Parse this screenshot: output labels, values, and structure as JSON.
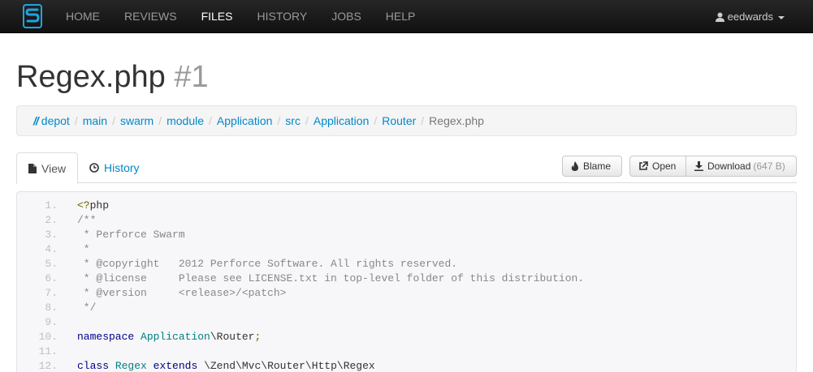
{
  "nav": {
    "items": [
      {
        "label": "HOME",
        "active": false
      },
      {
        "label": "REVIEWS",
        "active": false
      },
      {
        "label": "FILES",
        "active": true
      },
      {
        "label": "HISTORY",
        "active": false
      },
      {
        "label": "JOBS",
        "active": false
      },
      {
        "label": "HELP",
        "active": false
      }
    ],
    "user": "eedwards"
  },
  "page": {
    "title": "Regex.php",
    "revision": "#1"
  },
  "breadcrumb": {
    "root": "//",
    "items": [
      "depot",
      "main",
      "swarm",
      "module",
      "Application",
      "src",
      "Application",
      "Router"
    ],
    "current": "Regex.php",
    "separator": "/"
  },
  "tabs": {
    "view": "View",
    "history": "History"
  },
  "actions": {
    "blame": "Blame",
    "open": "Open",
    "download": "Download",
    "size": "(647 B)"
  },
  "code": {
    "lines": [
      {
        "n": "1.",
        "tokens": [
          [
            "c-punct",
            "<?"
          ],
          [
            "c-plain",
            "php"
          ]
        ]
      },
      {
        "n": "2.",
        "tokens": [
          [
            "c-comment",
            "/**"
          ]
        ]
      },
      {
        "n": "3.",
        "tokens": [
          [
            "c-comment",
            " * Perforce Swarm"
          ]
        ]
      },
      {
        "n": "4.",
        "tokens": [
          [
            "c-comment",
            " *"
          ]
        ]
      },
      {
        "n": "5.",
        "tokens": [
          [
            "c-comment",
            " * @copyright   2012 Perforce Software. All rights reserved."
          ]
        ]
      },
      {
        "n": "6.",
        "tokens": [
          [
            "c-comment",
            " * @license     Please see LICENSE.txt in top-level folder of this distribution."
          ]
        ]
      },
      {
        "n": "7.",
        "tokens": [
          [
            "c-comment",
            " * @version     <release>/<patch>"
          ]
        ]
      },
      {
        "n": "8.",
        "tokens": [
          [
            "c-comment",
            " */"
          ]
        ]
      },
      {
        "n": "9.",
        "tokens": []
      },
      {
        "n": "10.",
        "tokens": [
          [
            "c-kw",
            "namespace"
          ],
          [
            "c-plain",
            " "
          ],
          [
            "c-type",
            "Application"
          ],
          [
            "c-plain",
            "\\Router"
          ],
          [
            "c-punct",
            ";"
          ]
        ]
      },
      {
        "n": "11.",
        "tokens": []
      },
      {
        "n": "12.",
        "tokens": [
          [
            "c-kw",
            "class"
          ],
          [
            "c-plain",
            " "
          ],
          [
            "c-type",
            "Regex"
          ],
          [
            "c-plain",
            " "
          ],
          [
            "c-kw",
            "extends"
          ],
          [
            "c-plain",
            " \\Zend\\Mvc\\Router\\Http\\Regex"
          ]
        ]
      }
    ]
  },
  "colors": {
    "link": "#0088cc",
    "navbar": "#1b1b1b",
    "logo": "#1fa4e0"
  }
}
